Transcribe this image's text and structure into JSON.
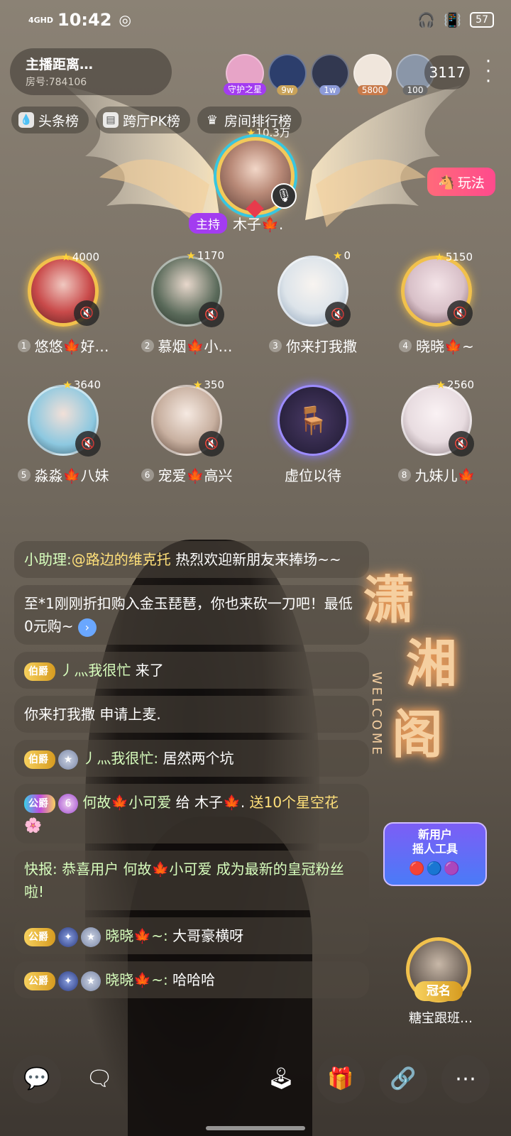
{
  "status": {
    "network": "4GHD",
    "time": "10:42",
    "battery": "57"
  },
  "room": {
    "name": "主播距离…",
    "id": "房号:784106"
  },
  "viewers": [
    {
      "tag": "守护之星",
      "color": "#a33cf0",
      "bg": "#e7a4c7"
    },
    {
      "tag": "9w",
      "color": "#c9a35a",
      "bg": "#2c3e6c"
    },
    {
      "tag": "1w",
      "color": "#8d9bd8",
      "bg": "#323850"
    },
    {
      "tag": "5800",
      "color": "#c87a4a",
      "bg": "#f0e6dc"
    },
    {
      "tag": "100",
      "color": "#6a6a6a",
      "bg": "#8a96a8"
    }
  ],
  "viewer_count": "3117",
  "ranks": [
    {
      "label": "头条榜",
      "icon": "drop-icon"
    },
    {
      "label": "跨厅PK榜",
      "icon": "flag-icon"
    },
    {
      "label": "房间排行榜",
      "icon": "crown-icon"
    }
  ],
  "host": {
    "score": "10.3万",
    "badge": "主持",
    "name": "木子🍁."
  },
  "play_button": "玩法",
  "seats": [
    {
      "num": "1",
      "name": "悠悠🍁好…",
      "score": "4000",
      "color": "#c94a4a"
    },
    {
      "num": "2",
      "name": "慕烟🍁小…",
      "score": "1170",
      "color": "#5a6a5a"
    },
    {
      "num": "3",
      "name": "你来打我撒",
      "score": "0",
      "color": "#dde4ea"
    },
    {
      "num": "4",
      "name": "晓晓🍁~",
      "score": "5150",
      "color": "#d8c0c8"
    },
    {
      "num": "5",
      "name": "淼淼🍁八妹",
      "score": "3640",
      "color": "#8cc8e0"
    },
    {
      "num": "6",
      "name": "宠爱🍁高兴",
      "score": "350",
      "color": "#c8b0a0"
    },
    {
      "num": "",
      "name": "虚位以待",
      "score": "",
      "color": ""
    },
    {
      "num": "8",
      "name": "九妹儿🍁",
      "score": "2560",
      "color": "#e8dce0"
    }
  ],
  "chat": {
    "m1_prefix": "小助理:",
    "m1_mention": "@路边的维克托",
    "m1_text": " 热烈欢迎新朋友来捧场~~",
    "m2_text": "至*1刚刚折扣购入金玉琵琶，你也来砍一刀吧！最低0元购~",
    "m3_rank": "伯爵",
    "m3_name": "丿灬我很忙",
    "m3_text": " 来了",
    "m4_text": "你来打我撒 申请上麦.",
    "m5_rank": "伯爵",
    "m5_name": "丿灬我很忙:",
    "m5_text": " 居然两个坑",
    "m6_rank": "公爵",
    "m6_level": "6",
    "m6_name": "何故🍁小可爱",
    "m6_mid": " 给 ",
    "m6_to": "木子🍁.",
    "m6_gift": " 送10个星空花",
    "m7_text": "快报: 恭喜用户 何故🍁小可爱 成为最新的皇冠粉丝啦!",
    "m8_rank": "公爵",
    "m8_name": "晓晓🍁~:",
    "m8_text": " 大哥豪横呀",
    "m9_rank": "公爵",
    "m9_name": "晓晓🍁~:",
    "m9_text": " 哈哈哈"
  },
  "logo": {
    "c1": "潇",
    "c2": "湘",
    "c3": "阁",
    "welcome": "WELCOME"
  },
  "promo": {
    "line1": "新用户",
    "line2": "摇人工具"
  },
  "crown": {
    "tag": "冠名",
    "name": "糖宝跟班…"
  },
  "bottom": [
    "chat-bubble-icon",
    "message-icon",
    "joystick-icon",
    "gift-icon",
    "link-icon",
    "more-icon"
  ]
}
